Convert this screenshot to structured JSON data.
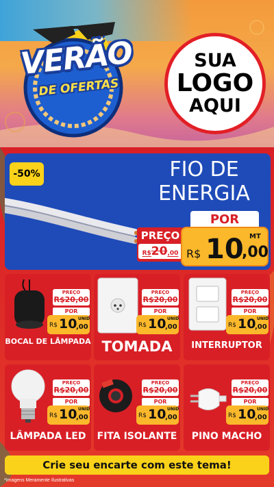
{
  "header": {
    "title_main": "VERÃO",
    "title_sub": "DE OFERTAS",
    "logo_line1": "SUA",
    "logo_line2": "LOGO",
    "logo_line3": "AQUI"
  },
  "featured": {
    "discount": "-50%",
    "title_line1": "FIO DE",
    "title_line2": "ENERGIA",
    "por_label": "POR",
    "preco_label": "PREÇO",
    "old_currency": "R$",
    "old_int": "20",
    "old_cents": ",00",
    "currency": "R$",
    "price_int": "10",
    "price_cents": ",00",
    "unit": "MT"
  },
  "products": [
    {
      "name": "BOCAL DE LÂMPADA",
      "preco_label": "PREÇO",
      "old": "R$20,00",
      "por_label": "POR",
      "currency": "R$",
      "price_int": "10",
      "price_cents": ",00",
      "unit": "UNID"
    },
    {
      "name": "TOMADA",
      "preco_label": "PREÇO",
      "old": "R$20,00",
      "por_label": "POR",
      "currency": "R$",
      "price_int": "10",
      "price_cents": ",00",
      "unit": "UNID"
    },
    {
      "name": "INTERRUPTOR",
      "preco_label": "PREÇO",
      "old": "R$20,00",
      "por_label": "POR",
      "currency": "R$",
      "price_int": "10",
      "price_cents": ",00",
      "unit": "UNID"
    },
    {
      "name": "LÂMPADA LED",
      "preco_label": "PREÇO",
      "old": "R$20,00",
      "por_label": "POR",
      "currency": "R$",
      "price_int": "10",
      "price_cents": ",00",
      "unit": "UNID"
    },
    {
      "name": "FITA ISOLANTE",
      "preco_label": "PREÇO",
      "old": "R$20,00",
      "por_label": "POR",
      "currency": "R$",
      "price_int": "10",
      "price_cents": ",00",
      "unit": "UNID"
    },
    {
      "name": "PINO MACHO",
      "preco_label": "PREÇO",
      "old": "R$20,00",
      "por_label": "POR",
      "currency": "R$",
      "price_int": "10",
      "price_cents": ",00",
      "unit": "UNID"
    }
  ],
  "cta": "Crie seu encarte com este tema!",
  "disclaimer": "*Imagens Meramente Ilustrativas",
  "colors": {
    "red": "#d81f26",
    "blue": "#1f4bb8",
    "yellow": "#fbd21a",
    "orange": "#fbb82b"
  }
}
